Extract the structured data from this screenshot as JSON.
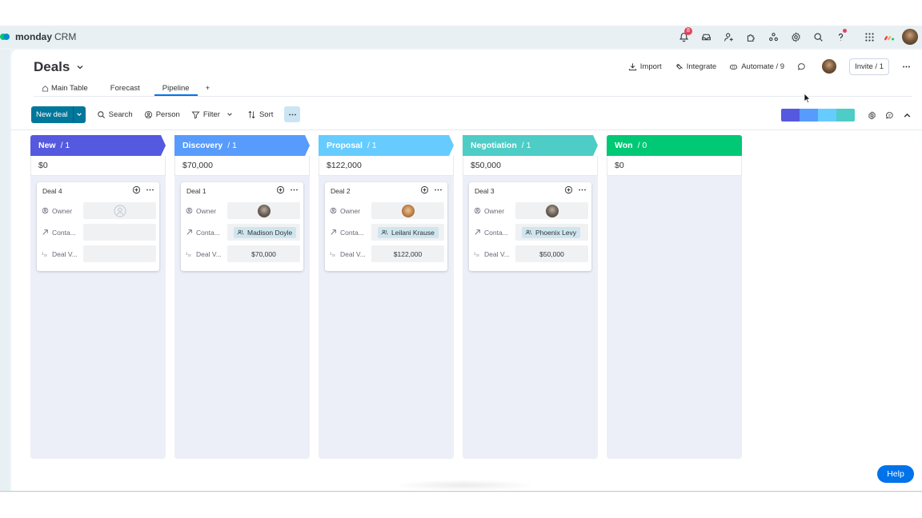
{
  "app": {
    "brand": "monday",
    "product": "CRM"
  },
  "topbar": {
    "notifications_count": "8"
  },
  "board": {
    "title": "Deals",
    "tabs": [
      {
        "label": "Main Table"
      },
      {
        "label": "Forecast"
      },
      {
        "label": "Pipeline"
      },
      {
        "label": "+"
      }
    ],
    "header_actions": {
      "import": "Import",
      "integrate": "Integrate",
      "automate": "Automate / 9",
      "invite": "Invite / 1"
    }
  },
  "toolbar": {
    "new_deal": "New deal",
    "search": "Search",
    "person": "Person",
    "filter": "Filter",
    "sort": "Sort"
  },
  "stage_colors": [
    "#5559df",
    "#579bfc",
    "#66ccff",
    "#4eccc6"
  ],
  "columns": [
    {
      "name": "New",
      "count": "/ 1",
      "sum": "$0",
      "color": "#5559df",
      "cards": [
        {
          "title": "Deal 4",
          "owner_label": "Owner",
          "contact_label": "Conta...",
          "value_label": "Deal V...",
          "owner": "empty",
          "contact": "",
          "value": ""
        }
      ]
    },
    {
      "name": "Discovery",
      "count": "/ 1",
      "sum": "$70,000",
      "color": "#579bfc",
      "cards": [
        {
          "title": "Deal 1",
          "owner_label": "Owner",
          "contact_label": "Conta...",
          "value_label": "Deal V...",
          "owner": "avatar",
          "contact": "Madison Doyle",
          "value": "$70,000"
        }
      ]
    },
    {
      "name": "Proposal",
      "count": "/ 1",
      "sum": "$122,000",
      "color": "#66ccff",
      "cards": [
        {
          "title": "Deal 2",
          "owner_label": "Owner",
          "contact_label": "Conta...",
          "value_label": "Deal V...",
          "owner": "avatar",
          "contact": "Leilani Krause",
          "value": "$122,000"
        }
      ]
    },
    {
      "name": "Negotiation",
      "count": "/ 1",
      "sum": "$50,000",
      "color": "#4eccc6",
      "cards": [
        {
          "title": "Deal 3",
          "owner_label": "Owner",
          "contact_label": "Conta...",
          "value_label": "Deal V...",
          "owner": "avatar",
          "contact": "Phoenix Levy",
          "value": "$50,000"
        }
      ]
    },
    {
      "name": "Won",
      "count": "/ 0",
      "sum": "$0",
      "color": "#00c875",
      "cards": []
    }
  ],
  "help": {
    "label": "Help"
  }
}
